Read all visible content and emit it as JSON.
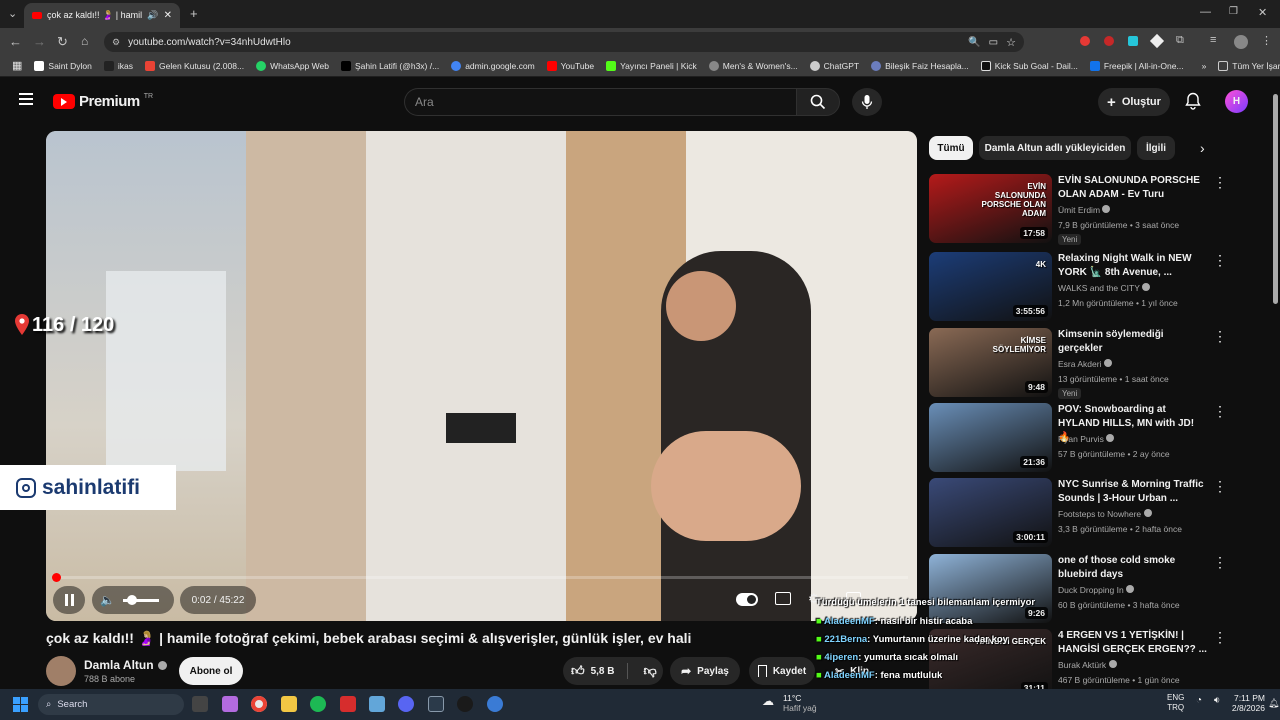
{
  "browser": {
    "tab_title": "çok az kaldı!! 🤰🏼 | hamile foto",
    "url": "youtube.com/watch?v=34nhUdwtHlo",
    "bookmarks": [
      {
        "label": "Saint Dylon",
        "color": "#ffffff"
      },
      {
        "label": "ikas",
        "color": "#111111"
      },
      {
        "label": "Gelen Kutusu (2.008...",
        "color": "#ea4335"
      },
      {
        "label": "WhatsApp Web",
        "color": "#25d366"
      },
      {
        "label": "Şahin Latifi (@h3x) /...",
        "color": "#000000"
      },
      {
        "label": "admin.google.com",
        "color": "#4285f4"
      },
      {
        "label": "YouTube",
        "color": "#ff0000"
      },
      {
        "label": "Yayıncı Paneli | Kick",
        "color": "#53fc18"
      },
      {
        "label": "Men's & Women's...",
        "color": "#888888"
      },
      {
        "label": "ChatGPT",
        "color": "#cccccc"
      },
      {
        "label": "Bileşik Faiz Hesapla...",
        "color": "#6b7dbd"
      },
      {
        "label": "Kick Sub Goal - Dail...",
        "color": "#111111"
      },
      {
        "label": "Freepik | All-in-One...",
        "color": "#1273eb"
      }
    ],
    "all_bookmarks": "Tüm Yer İşaretleri"
  },
  "header": {
    "logo": "Premium",
    "logo_sup": "TR",
    "search_placeholder": "Ara",
    "create_label": "Oluştur"
  },
  "video": {
    "counter": "116 / 120",
    "watermark": "sahinlatifi",
    "time": "0:02 / 45:22",
    "progress": 0.001,
    "title": "çok az kaldı!! 🤰🏼 | hamile fotoğraf çekimi, bebek arabası seçimi & alışverişler, günlük işler, ev hali",
    "channel": "Damla Altun",
    "subscribers": "788 B abone",
    "subscribe_label": "Abone ol",
    "likes": "5,8 B",
    "share_label": "Paylaş",
    "save_label": "Kaydet",
    "clip_label": "Klip"
  },
  "chips": [
    "Tümü",
    "Damla Altun adlı yükleyiciden",
    "İlgili"
  ],
  "recommendations": [
    {
      "title": "EVİN SALONUNDA PORSCHE OLAN ADAM - Ev Turu",
      "channel": "Ümit Erdim",
      "meta": "7,9 B görüntüleme • 3 saat önce",
      "badge": "Yeni",
      "duration": "17:58",
      "thumb_text": "EVİN SALONUNDA PORSCHE OLAN ADAM",
      "color": "#b51a1a"
    },
    {
      "title": "Relaxing Night Walk in NEW YORK 🗽 8th Avenue, ...",
      "channel": "WALKS and the CITY",
      "meta": "1,2 Mn görüntüleme • 1 yıl önce",
      "badge": "",
      "duration": "3:55:56",
      "thumb_text": "4K",
      "color": "#1c3d78"
    },
    {
      "title": "Kimsenin söylemediği gerçekler",
      "channel": "Esra Akderi",
      "meta": "13 görüntüleme • 1 saat önce",
      "badge": "Yeni",
      "duration": "9:48",
      "thumb_text": "KİMSE SÖYLEMİYOR",
      "color": "#8a6a55"
    },
    {
      "title": "POV: Snowboarding at HYLAND HILLS, MN with JD! 🔥",
      "channel": "Ryan Purvis",
      "meta": "57 B görüntüleme • 2 ay önce",
      "badge": "",
      "duration": "21:36",
      "thumb_text": "",
      "color": "#6a8fb8"
    },
    {
      "title": "NYC Sunrise & Morning Traffic Sounds | 3-Hour Urban ...",
      "channel": "Footsteps to Nowhere",
      "meta": "3,3 B görüntüleme • 2 hafta önce",
      "badge": "",
      "duration": "3:00:11",
      "thumb_text": "",
      "color": "#3a4a78"
    },
    {
      "title": "one of those cold smoke bluebird days",
      "channel": "Duck Dropping In",
      "meta": "60 B görüntüleme • 3 hafta önce",
      "badge": "",
      "duration": "9:26",
      "thumb_text": "",
      "color": "#8fb3d8"
    },
    {
      "title": "4 ERGEN VS 1 YETİŞKİN! | HANGİSİ GERÇEK ERGEN?? ...",
      "channel": "Burak Aktürk",
      "meta": "467 B görüntüleme • 1 gün önce",
      "badge": "",
      "duration": "31:11",
      "thumb_text": "HANGİSİ GERÇEK",
      "color": "#3a2a2a"
    }
  ],
  "chat": [
    {
      "user": "AladeenMF",
      "text": ": nasıl bir histir acaba"
    },
    {
      "user": "221Berna",
      "text": ": Yumurtanın üzerine kadar koy"
    },
    {
      "user": "4iperen",
      "text": ": yumurta sıcak olmalı"
    },
    {
      "user": "AladeenMF",
      "text": ": fena mutluluk"
    },
    {
      "user": "lolhamed",
      "text": ": bu videoyu kapatın ilerde mina çok fena giyiniyo ağlarım"
    }
  ],
  "chat_top": "Türdüğü ümelerin 1 tanesi bilemanlam içermiyor",
  "taskbar": {
    "search": "Search",
    "weather": "11°C",
    "weather_sub": "Hafif yağ",
    "lang": "ENG",
    "lang2": "TRQ",
    "time": "7:11 PM",
    "date": "2/8/2026"
  }
}
